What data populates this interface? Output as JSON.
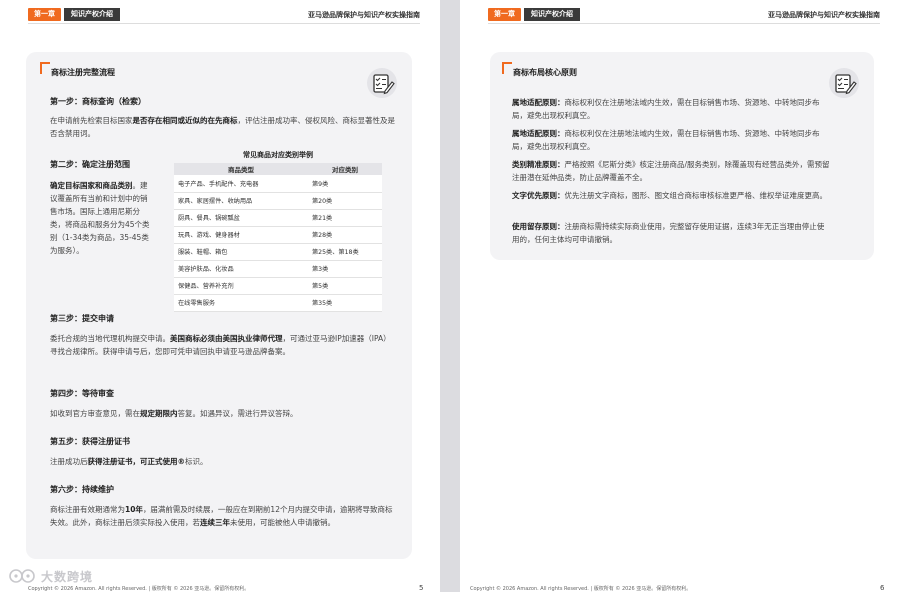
{
  "header": {
    "chapter": "第一章",
    "section": "知识产权介绍",
    "doc_title": "亚马逊品牌保护与知识产权实操指南"
  },
  "left": {
    "card_title": "商标注册完整流程",
    "step1": {
      "heading": "第一步：商标查询（检索）",
      "t1": "在申请前先检索目标国家",
      "b1": "是否存在相同或近似的在先商标",
      "t2": "，评估注册成功率、侵权风险、商标显著性及是否含禁用词。"
    },
    "step2": {
      "heading": "第二步：确定注册范围",
      "b1": "确定目标国家和商品类别",
      "t1": "。建议覆盖所有当前和计划中的销售市场。国际上通用尼斯分类，将商品和服务分为45个类别（1-34类为商品，35-45类为服务）。"
    },
    "table": {
      "caption": "常见商品对应类别举例",
      "col1": "商品类型",
      "col2": "对应类别",
      "rows": [
        {
          "type": "电子产品、手机配件、充电器",
          "cls": "第9类"
        },
        {
          "type": "家具、家居摆件、收纳用品",
          "cls": "第20类"
        },
        {
          "type": "厨具、餐具、锅碗瓢盆",
          "cls": "第21类"
        },
        {
          "type": "玩具、游戏、健身器材",
          "cls": "第28类"
        },
        {
          "type": "服装、鞋帽、箱包",
          "cls": "第25类、第18类"
        },
        {
          "type": "美容护肤品、化妆品",
          "cls": "第3类"
        },
        {
          "type": "保健品、营养补充剂",
          "cls": "第5类"
        },
        {
          "type": "在线零售服务",
          "cls": "第35类"
        }
      ]
    },
    "step3": {
      "heading": "第三步：提交申请",
      "t1": "委托合规的当地代理机构提交申请。",
      "b1": "美国商标必须由美国执业律师代理",
      "t2": "，可通过亚马逊IP加速器（IPA）寻找合规律所。获得申请号后，您即可凭申请回执申请亚马逊品牌备案。"
    },
    "step4": {
      "heading": "第四步：等待审查",
      "t1": "如收到官方审查意见，需在",
      "b1": "规定期限内",
      "t2": "答复。如遇异议，需进行异议答辩。"
    },
    "step5": {
      "heading": "第五步：获得注册证书",
      "t1": "注册成功后",
      "b1": "获得注册证书，可正式使用®",
      "t2": "标识。"
    },
    "step6": {
      "heading": "第六步：持续维护",
      "t1": "商标注册有效期通常为",
      "b1": "10年",
      "t2": "，届满前需及时续展，一般应在到期前12个月内提交申请，逾期将导致商标失效。此外，商标注册后须实际投入使用，若",
      "b2": "连续三年",
      "t3": "未使用，可能被他人申请撤销。"
    },
    "footer": "Copyright © 2026 Amazon. All rights Reserved. | 版权所有 © 2026 亚马逊。保留所有权利。",
    "page_num": "5"
  },
  "right": {
    "card_title": "商标布局核心原则",
    "p1": {
      "label": "属地适配原则：",
      "text": "商标权利仅在注册地法域内生效，需在目标销售市场、货源地、中转地同步布局，避免出现权利真空。"
    },
    "p2": {
      "label": "属地适配原则：",
      "text": "商标权利仅在注册地法域内生效，需在目标销售市场、货源地、中转地同步布局，避免出现权利真空。"
    },
    "p3": {
      "label": "类别精准原则：",
      "text": "严格按照《尼斯分类》核定注册商品/服务类别，除覆盖现有经营品类外，需预留注册潜在延伸品类，防止品牌覆盖不全。"
    },
    "p4": {
      "label": "文字优先原则：",
      "text": "优先注册文字商标，图形、图文组合商标审核标准更严格、维权举证难度更高。"
    },
    "p5": {
      "label": "使用留存原则：",
      "text": "注册商标需持续实际商业使用，完整留存使用证据，连续3年无正当理由停止使用的，任何主体均可申请撤销。"
    },
    "footer": "Copyright © 2026 Amazon. All rights Reserved. | 版权所有 © 2026 亚马逊。保留所有权利。",
    "page_num": "6"
  },
  "watermark": "大数跨境",
  "colors": {
    "accent": "#f06a1f",
    "card_bg": "#f3f3f5",
    "dark_chip": "#3a3a3a"
  }
}
